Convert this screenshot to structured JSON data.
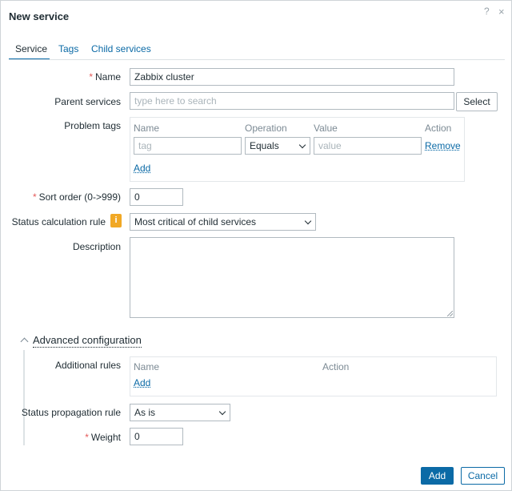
{
  "dialog": {
    "title": "New service",
    "help_icon": "?",
    "close_icon": "×"
  },
  "tabs": [
    {
      "label": "Service",
      "active": true
    },
    {
      "label": "Tags",
      "active": false
    },
    {
      "label": "Child services",
      "active": false
    }
  ],
  "form": {
    "name": {
      "label": "Name",
      "required": true,
      "value": "Zabbix cluster"
    },
    "parent_services": {
      "label": "Parent services",
      "placeholder": "type here to search",
      "select_label": "Select"
    },
    "problem_tags": {
      "label": "Problem tags",
      "headers": {
        "name": "Name",
        "operation": "Operation",
        "value": "Value",
        "action": "Action"
      },
      "row": {
        "tag_placeholder": "tag",
        "operation": "Equals",
        "value_placeholder": "value",
        "remove_label": "Remove"
      },
      "add_label": "Add"
    },
    "sort_order": {
      "label": "Sort order (0->999)",
      "required": true,
      "value": "0"
    },
    "status_calc_rule": {
      "label": "Status calculation rule",
      "info_icon": "i",
      "value": "Most critical of child services"
    },
    "description": {
      "label": "Description",
      "value": ""
    }
  },
  "advanced": {
    "toggle_label": "Advanced configuration",
    "additional_rules": {
      "label": "Additional rules",
      "headers": {
        "name": "Name",
        "action": "Action"
      },
      "add_label": "Add"
    },
    "status_propagation": {
      "label": "Status propagation rule",
      "value": "As is"
    },
    "weight": {
      "label": "Weight",
      "required": true,
      "value": "0"
    }
  },
  "footer": {
    "add_label": "Add",
    "cancel_label": "Cancel"
  },
  "colors": {
    "accent": "#0b6aa6",
    "required": "#e45959",
    "info": "#f1a825"
  },
  "icons": {
    "help": "help-icon",
    "close": "close-icon",
    "info": "info-icon",
    "collapse": "chevron-up-icon",
    "dropdown": "chevron-down-icon"
  }
}
